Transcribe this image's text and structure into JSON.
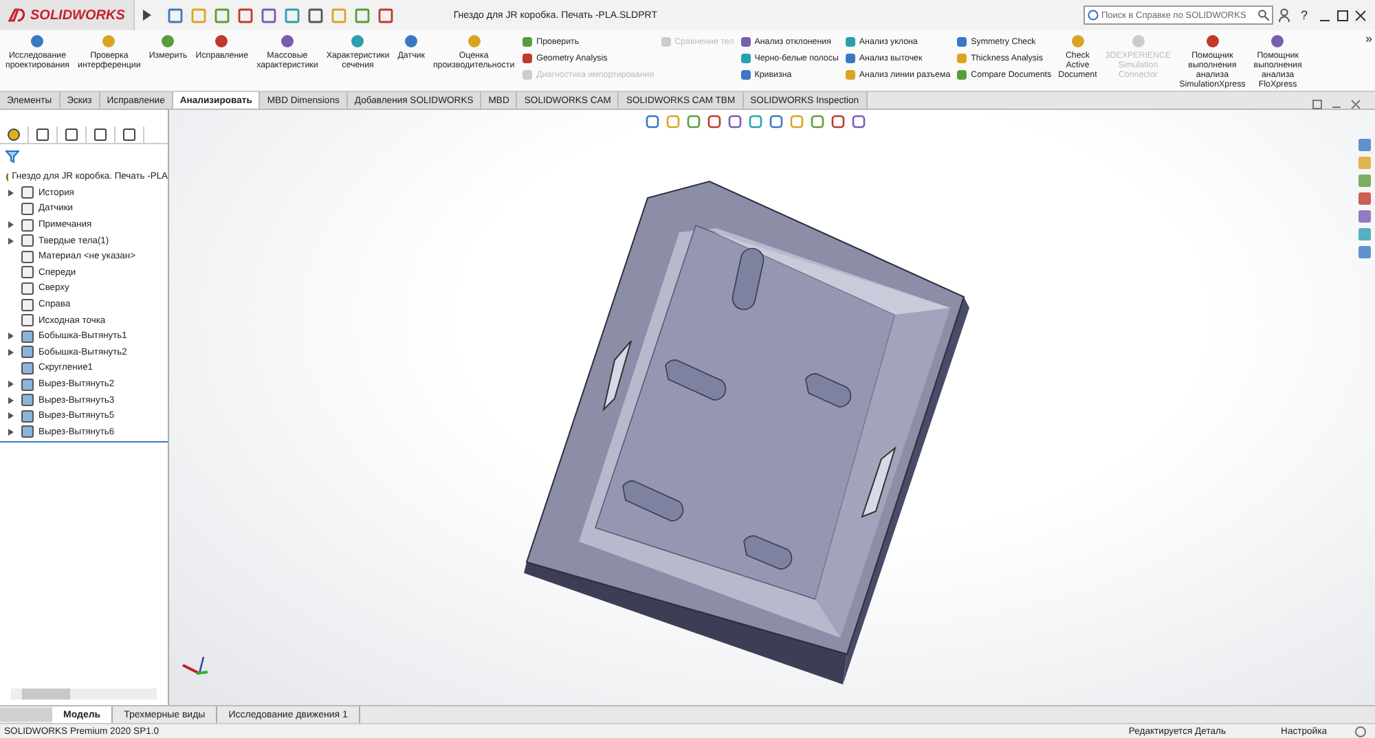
{
  "app": {
    "name": "SOLIDWORKS"
  },
  "window": {
    "title": "Гнездо для JR коробка. Печать -PLA.SLDPRT"
  },
  "search": {
    "placeholder": "Поиск в Справке по SOLIDWORKS"
  },
  "help_label": "?",
  "ribbon": [
    {
      "kind": "large",
      "label": "Исследование проектирования",
      "disabled": false
    },
    {
      "kind": "large",
      "label": "Проверка интерференции",
      "disabled": false
    },
    {
      "kind": "large",
      "label": "Измерить",
      "disabled": false
    },
    {
      "kind": "large",
      "label": "Исправление",
      "disabled": false
    },
    {
      "kind": "large",
      "label": "Массовые характеристики",
      "disabled": false
    },
    {
      "kind": "large",
      "label": "Характеристики сечения",
      "disabled": false
    },
    {
      "kind": "large",
      "label": "Датчик",
      "disabled": false
    },
    {
      "kind": "large",
      "label": "Оценка производительности",
      "disabled": false
    },
    {
      "kind": "stack",
      "items": [
        {
          "label": "Проверить",
          "disabled": false
        },
        {
          "label": "Geometry Analysis",
          "disabled": false
        },
        {
          "label": "Диагностика импортирования",
          "disabled": true
        }
      ]
    },
    {
      "kind": "stack",
      "items": [
        {
          "label": "Сравнение тел",
          "disabled": true
        }
      ]
    },
    {
      "kind": "stack",
      "items": [
        {
          "label": "Анализ отклонения",
          "disabled": false
        },
        {
          "label": "Черно-белые полосы",
          "disabled": false
        },
        {
          "label": "Кривизна",
          "disabled": false
        }
      ]
    },
    {
      "kind": "stack",
      "items": [
        {
          "label": "Анализ уклона",
          "disabled": false
        },
        {
          "label": "Анализ выточек",
          "disabled": false
        },
        {
          "label": "Анализ линии разъема",
          "disabled": false
        }
      ]
    },
    {
      "kind": "stack",
      "items": [
        {
          "label": "Symmetry Check",
          "disabled": false
        },
        {
          "label": "Thickness Analysis",
          "disabled": false
        },
        {
          "label": "Compare Documents",
          "disabled": false
        }
      ]
    },
    {
      "kind": "large",
      "label": "Check Active Document",
      "disabled": false
    },
    {
      "kind": "large",
      "label": "3DEXPERIENCE Simulation Connector",
      "disabled": true
    },
    {
      "kind": "large",
      "label": "Помощник выполнения анализа SimulationXpress",
      "disabled": false
    },
    {
      "kind": "large",
      "label": "Помощник выполнения анализа FloXpress",
      "disabled": false
    }
  ],
  "ribbon_more": "»",
  "tabs": [
    {
      "label": "Элементы",
      "selected": false
    },
    {
      "label": "Эскиз",
      "selected": false
    },
    {
      "label": "Исправление",
      "selected": false
    },
    {
      "label": "Анализировать",
      "selected": true
    },
    {
      "label": "MBD Dimensions",
      "selected": false
    },
    {
      "label": "Добавления SOLIDWORKS",
      "selected": false
    },
    {
      "label": "MBD",
      "selected": false
    },
    {
      "label": "SOLIDWORKS CAM",
      "selected": false
    },
    {
      "label": "SOLIDWORKS CAM TBM",
      "selected": false
    },
    {
      "label": "SOLIDWORKS Inspection",
      "selected": false
    }
  ],
  "feature_tree": {
    "root": "Гнездо для JR коробка. Печать -PLA",
    "items": [
      {
        "label": "История",
        "expandable": true
      },
      {
        "label": "Датчики",
        "expandable": false
      },
      {
        "label": "Примечания",
        "expandable": true
      },
      {
        "label": "Твердые тела(1)",
        "expandable": true
      },
      {
        "label": "Материал <не указан>",
        "expandable": false
      },
      {
        "label": "Спереди",
        "expandable": false
      },
      {
        "label": "Сверху",
        "expandable": false
      },
      {
        "label": "Справа",
        "expandable": false
      },
      {
        "label": "Исходная точка",
        "expandable": false
      },
      {
        "label": "Бобышка-Вытянуть1",
        "expandable": true
      },
      {
        "label": "Бобышка-Вытянуть2",
        "expandable": true
      },
      {
        "label": "Скругление1",
        "expandable": false
      },
      {
        "label": "Вырез-Вытянуть2",
        "expandable": true
      },
      {
        "label": "Вырез-Вытянуть3",
        "expandable": true
      },
      {
        "label": "Вырез-Вытянуть5",
        "expandable": true
      },
      {
        "label": "Вырез-Вытянуть6",
        "expandable": true
      }
    ]
  },
  "bottom_tabs": [
    {
      "label": "Модель",
      "selected": true
    },
    {
      "label": "Трехмерные виды",
      "selected": false
    },
    {
      "label": "Исследование движения 1",
      "selected": false
    }
  ],
  "status_bar": {
    "product": "SOLIDWORKS Premium 2020 SP1.0",
    "mode": "Редактируется Деталь",
    "settings": "Настройка"
  }
}
